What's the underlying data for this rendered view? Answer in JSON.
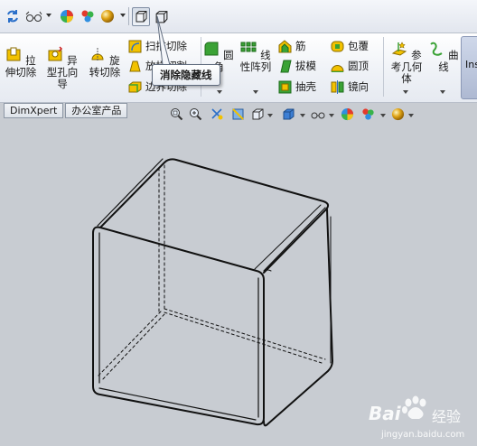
{
  "ribbon": {
    "extrude_cut": "拉伸切除",
    "hole_wizard": "异型孔向导",
    "revolve_cut": "旋转切除",
    "swept_cut": "扫描切除",
    "lofted_cut": "放样切割",
    "boundary_cut": "边界切除",
    "fillet": "圆角",
    "linear_pattern": "线性阵列",
    "rib": "筋",
    "draft": "拔模",
    "shell": "抽壳",
    "wrap": "包覆",
    "dome": "圆顶",
    "mirror": "镜向",
    "ref_geometry": "参考几何体",
    "curves": "曲线",
    "instant3d": "Ins"
  },
  "tooltip": "消除隐藏线",
  "tabs": [
    "DimXpert",
    "办公室产品"
  ],
  "watermark": {
    "brand": "Bai",
    "brand_cn": "经验",
    "url": "jingyan.baidu.com"
  },
  "colors": {
    "ribbon_bg": "#eef1f6",
    "viewport_bg": "#c8ccd2",
    "accent_yellow": "#f2c200",
    "accent_green": "#3aa235"
  }
}
